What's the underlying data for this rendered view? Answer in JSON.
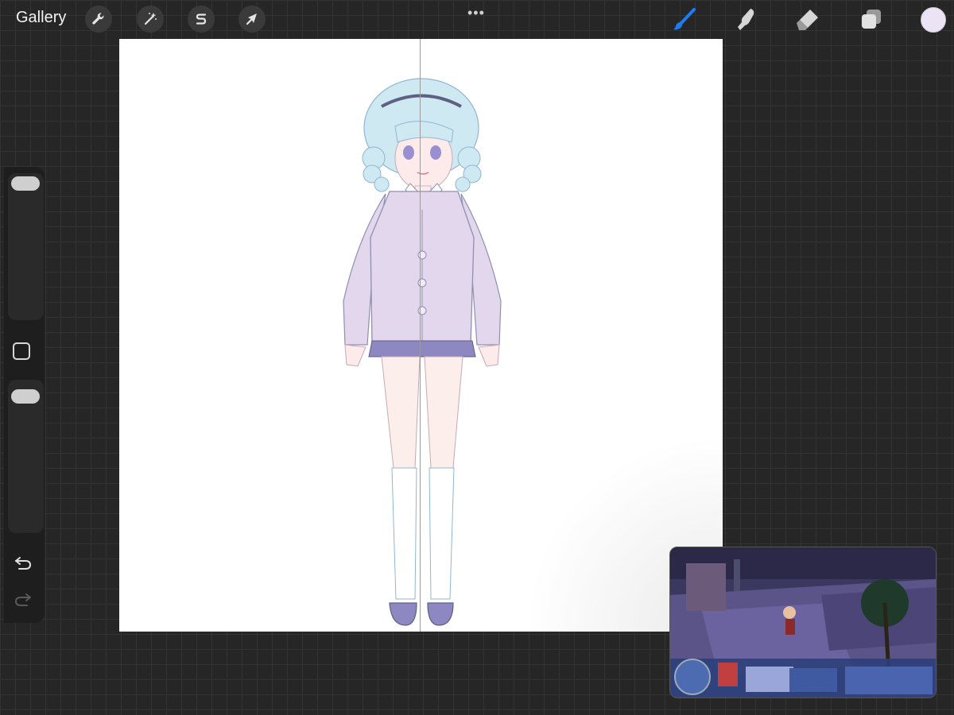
{
  "toolbar": {
    "gallery_label": "Gallery",
    "left_tools": [
      {
        "name": "actions",
        "icon": "wrench-icon"
      },
      {
        "name": "adjustments",
        "icon": "magic-wand-icon"
      },
      {
        "name": "selection",
        "icon": "selection-s-icon"
      },
      {
        "name": "transform",
        "icon": "arrow-cursor-icon"
      }
    ],
    "more_label": "•••",
    "right_tools": [
      {
        "name": "brush",
        "icon": "brush-icon",
        "active": true
      },
      {
        "name": "smudge",
        "icon": "smudge-finger-icon",
        "active": false
      },
      {
        "name": "eraser",
        "icon": "eraser-icon",
        "active": false
      },
      {
        "name": "layers",
        "icon": "layers-icon",
        "active": false
      }
    ],
    "color": "#ece4f4",
    "accent": "#1e7cf2"
  },
  "canvas": {
    "background": "#ffffff",
    "has_vertical_guide": true
  },
  "sidebar": {
    "brush_size_level": 0.95,
    "opacity_level": 0.95
  },
  "pip": {
    "description_colors": {
      "sky": "#3b3860",
      "ground": "#5a5488"
    }
  }
}
